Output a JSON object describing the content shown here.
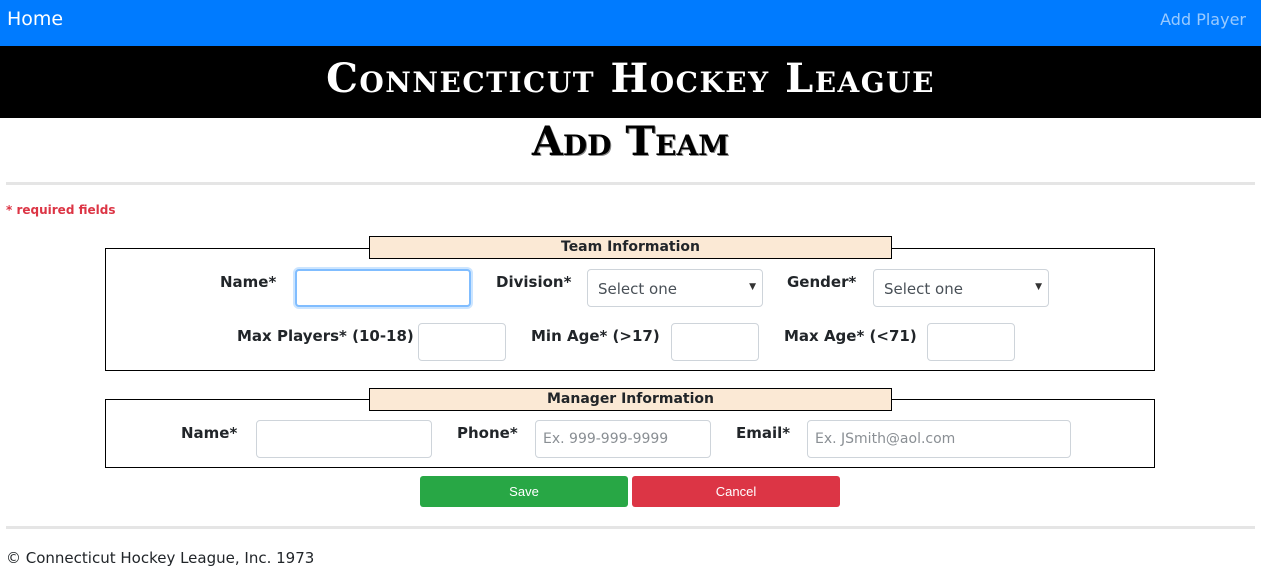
{
  "nav": {
    "home": "Home",
    "add_player": "Add Player"
  },
  "banner": {
    "title": "Connecticut Hockey League"
  },
  "page": {
    "title": "Add Team",
    "required_note": "* required fields"
  },
  "team_info": {
    "legend": "Team Information",
    "name_label": "Name*",
    "name_value": "",
    "division_label": "Division*",
    "division_selected": "Select one",
    "gender_label": "Gender*",
    "gender_selected": "Select one",
    "max_players_label": "Max Players* (10-18)",
    "min_age_label": "Min Age* (>17)",
    "max_age_label": "Max Age* (<71)"
  },
  "manager_info": {
    "legend": "Manager Information",
    "name_label": "Name*",
    "phone_label": "Phone*",
    "phone_placeholder": "Ex. 999-999-9999",
    "email_label": "Email*",
    "email_placeholder": "Ex. JSmith@aol.com"
  },
  "buttons": {
    "save": "Save",
    "cancel": "Cancel"
  },
  "footer": {
    "copyright": "© Connecticut Hockey League, Inc. 1973"
  },
  "colors": {
    "nav_bg": "#007bff",
    "banner_bg": "#000000",
    "legend_bg": "#fbe9d5",
    "required": "#dc3545",
    "save": "#28a745",
    "cancel": "#dc3545"
  }
}
